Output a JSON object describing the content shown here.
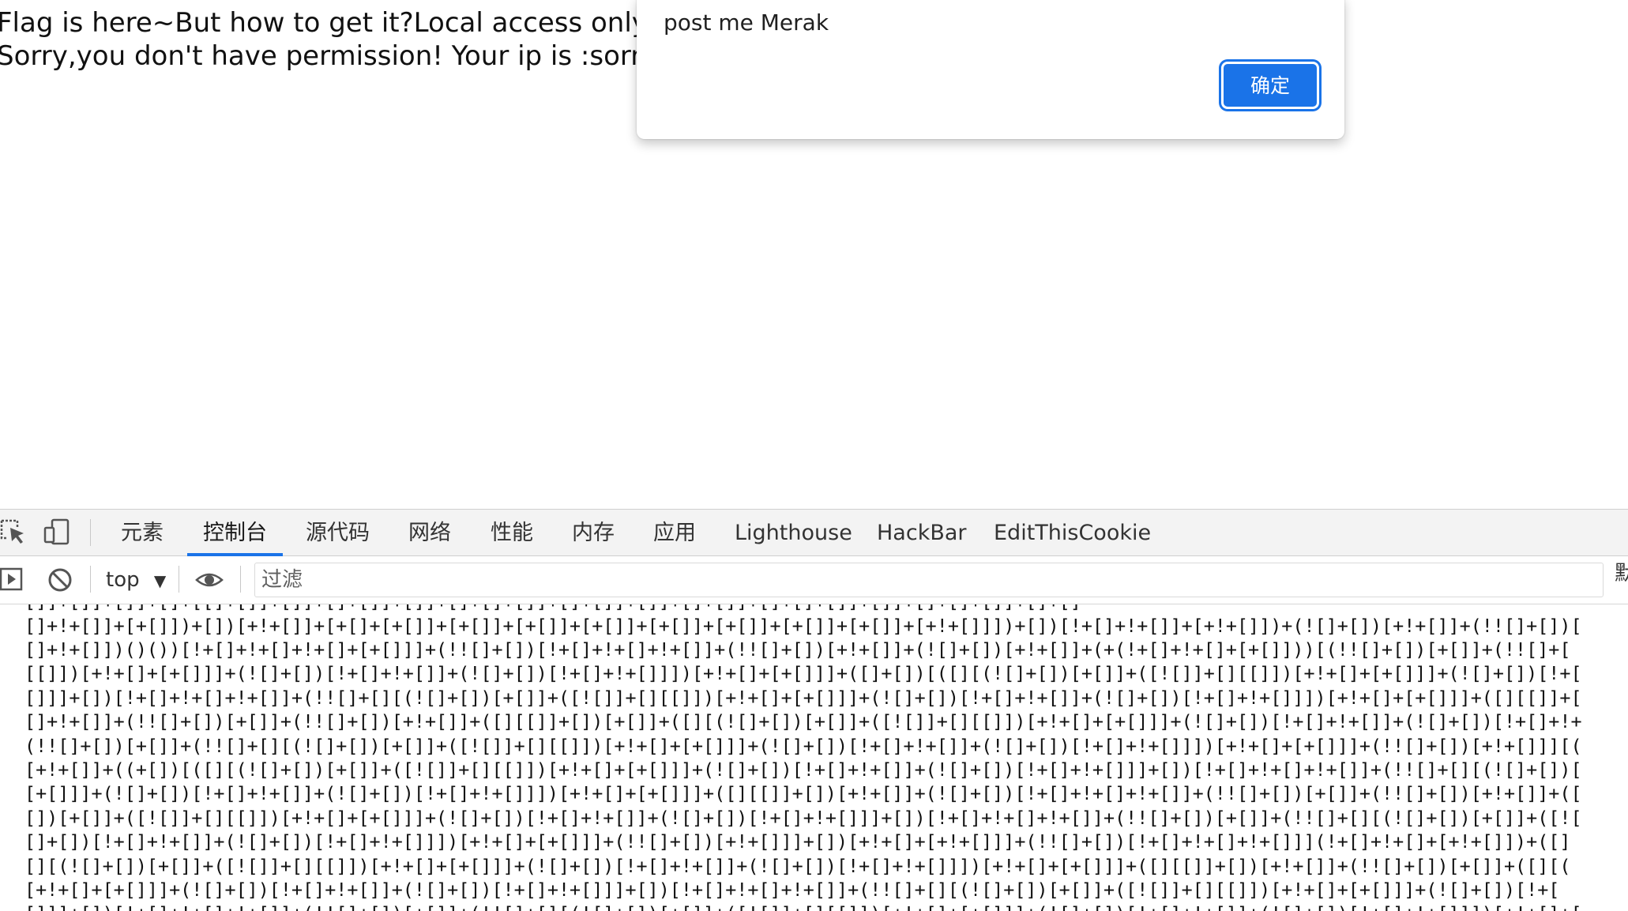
{
  "page": {
    "line1": "Flag is here~But how to get it?Local access only!",
    "line2": "Sorry,you don't have permission!  Your ip is :sorry,this"
  },
  "alert": {
    "message": "post me Merak",
    "ok_label": "确定"
  },
  "devtools": {
    "tabs": [
      "元素",
      "控制台",
      "源代码",
      "网络",
      "性能",
      "内存",
      "应用",
      "Lighthouse",
      "HackBar",
      "EditThisCookie"
    ],
    "active_tab": "控制台",
    "context": "top",
    "filter_placeholder": "过滤",
    "default_levels_partial": "默"
  },
  "console": {
    "lines": [
      "[]]+[]]+[]]+[]+[[]+[]]+[]]+[]+[]]+[]]+[]+[]+[]]+[]+[]]+[]]+[]+[]]+[]+[]+[]]+[]]+[]+[]+[]]+[]+[]",
      "[]+!+[]]+[+[]])+[])[+!+[]]+[+[]+[+[]]+[+[]]+[+[]]+[+[]]+[+[]]+[+[]]+[+[]]+[+[]]+[+!+[]]])+[])[!+[]+!+[]]+[+!+[]])+(![]+[])[+!+[]]+(!![]+[])[",
      "[]+!+[]])()())[!+[]+!+[]+!+[]+[+[]]]+(!![]+[])[!+[]+!+[]+!+[]]+(!![]+[])[+!+[]]+(![]+[])[+!+[]]+(+(!+[]+!+[]+[+[]]))[(!![]+[])[+[]]+(!![]+[",
      "[[]])[+!+[]+[+[]]]+(![]+[])[!+[]+!+[]]+(![]+[])[!+[]+!+[]]])[+!+[]+[+[]]]+([]+[])[([][(![]+[])[+[]]+([![]]+[][[]])[+!+[]+[+[]]]+(![]+[])[!+[",
      "[]]]+[])[!+[]+!+[]+!+[]]+(!![]+[][(![]+[])[+[]]+([![]]+[][[]])[+!+[]+[+[]]]+(![]+[])[!+[]+!+[]]+(![]+[])[!+[]+!+[]]])[+!+[]+[+[]]]+([][[]]+[",
      "[]+!+[]]+(!![]+[])[+[]]+(!![]+[])[+!+[]]+([][[]]+[])[+[]]+([][(![]+[])[+[]]+([![]]+[][[]])[+!+[]+[+[]]]+(![]+[])[!+[]+!+[]]+(![]+[])[!+[]+!+",
      "(!![]+[])[+[]]+(!![]+[][(![]+[])[+[]]+([![]]+[][[]])[+!+[]+[+[]]]+(![]+[])[!+[]+!+[]]+(![]+[])[!+[]+!+[]]])[+!+[]+[+[]]]+(!![]+[])[+!+[]]][(",
      "[+!+[]]+((+[])[([][(![]+[])[+[]]+([![]]+[][[]])[+!+[]+[+[]]]+(![]+[])[!+[]+!+[]]+(![]+[])[!+[]+!+[]]]+[])[!+[]+!+[]+!+[]]+(!![]+[][(![]+[])[",
      "[+[]]]+(![]+[])[!+[]+!+[]]+(![]+[])[!+[]+!+[]]])[+!+[]+[+[]]]+([][[]]+[])[+!+[]]+(![]+[])[!+[]+!+[]+!+[]]+(!![]+[])[+[]]+(!![]+[])[+!+[]]+([",
      "[])[+[]]+([![]]+[][[]])[+!+[]+[+[]]]+(![]+[])[!+[]+!+[]]+(![]+[])[!+[]+!+[]]]+[])[!+[]+!+[]+!+[]]+(!![]+[])[+[]]+(!![]+[][(![]+[])[+[]]+([![",
      "[]+[])[!+[]+!+[]]+(![]+[])[!+[]+!+[]]])[+!+[]+[+[]]]+(!![]+[])[+!+[]]]+[])[+!+[]+[+!+[]]]+(!![]+[])[!+[]+!+[]+!+[]]](!+[]+!+[]+[+!+[]])+([]",
      "[][(![]+[])[+[]]+([![]]+[][[]])[+!+[]+[+[]]]+(![]+[])[!+[]+!+[]]+(![]+[])[!+[]+!+[]]])[+!+[]+[+[]]]+([][[]]+[])[+!+[]]+(!![]+[])[+[]]+([][(",
      "[+!+[]+[+[]]]+(![]+[])[!+[]+!+[]]+(![]+[])[!+[]+!+[]]]+[])[!+[]+!+[]+!+[]]+(!![]+[][(![]+[])[+[]]+([![]]+[][[]])[+!+[]+[+[]]]+(![]+[])[!+[",
      "[]]]+[])[!+[]+!+[]+!+[]]+(!![]+[])[+[]]+(!![]+[][(![]+[])[+[]]+([![]]+[][[]])[+!+[]+[+[]]]+(![]+[])[!+[]+!+[]]+(![]+[])[!+[]+!+[]]])[+!+[]+["
    ]
  }
}
